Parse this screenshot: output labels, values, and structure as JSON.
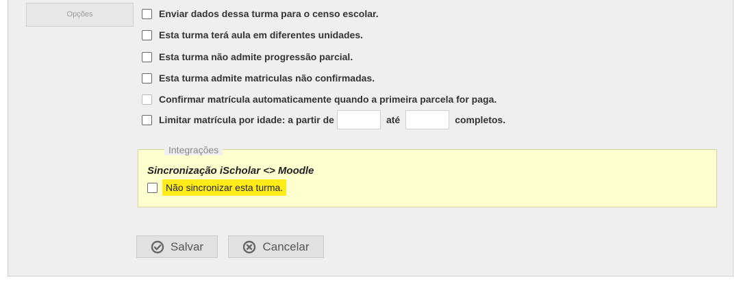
{
  "section": {
    "label": "Opções"
  },
  "options": [
    {
      "label": "Enviar dados dessa turma para o censo escolar.",
      "checked": false,
      "disabled": false
    },
    {
      "label": "Esta turma terá aula em diferentes unidades.",
      "checked": false,
      "disabled": false
    },
    {
      "label": "Esta turma não admite progressão parcial.",
      "checked": false,
      "disabled": false
    },
    {
      "label": "Esta turma admite matriculas não confirmadas.",
      "checked": false,
      "disabled": false
    },
    {
      "label": "Confirmar matrícula automaticamente quando a primeira parcela for paga.",
      "checked": false,
      "disabled": true
    }
  ],
  "age_limit": {
    "label_start": "Limitar matrícula por idade: a partir de",
    "label_mid": "até",
    "label_end": "completos.",
    "from_value": "",
    "to_value": ""
  },
  "integrations": {
    "legend": "Integrações",
    "title": "Sincronização iScholar <> Moodle",
    "option_label": "Não sincronizar esta turma.",
    "highlight_color": "#ffec19"
  },
  "buttons": {
    "save_label": "Salvar",
    "save_icon": "check-circle-icon",
    "cancel_label": "Cancelar",
    "cancel_icon": "x-circle-icon"
  }
}
